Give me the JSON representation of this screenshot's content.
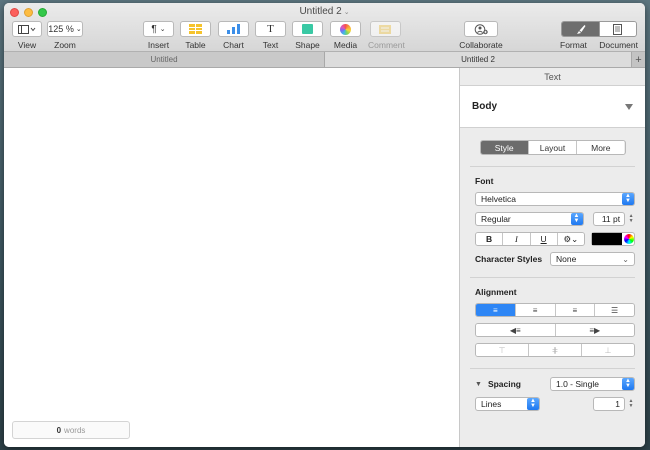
{
  "window": {
    "title": "Untitled 2"
  },
  "toolbar": {
    "view_label": "View",
    "zoom_value": "125 %",
    "zoom_label": "Zoom",
    "insert_label": "Insert",
    "table_label": "Table",
    "chart_label": "Chart",
    "text_label": "Text",
    "shape_label": "Shape",
    "media_label": "Media",
    "comment_label": "Comment",
    "collaborate_label": "Collaborate",
    "format_label": "Format",
    "document_label": "Document"
  },
  "tabs": [
    {
      "label": "Untitled",
      "active": false
    },
    {
      "label": "Untitled 2",
      "active": true
    }
  ],
  "canvas": {
    "word_count": "0",
    "word_count_unit": "words"
  },
  "inspector": {
    "title": "Text",
    "paragraph_style": "Body",
    "subtabs": [
      "Style",
      "Layout",
      "More"
    ],
    "font_section": "Font",
    "font_family": "Helvetica",
    "font_typeface": "Regular",
    "font_size": "11 pt",
    "bold": "B",
    "italic": "I",
    "underline": "U",
    "text_color": "#000000",
    "character_styles_label": "Character Styles",
    "character_styles_value": "None",
    "alignment_section": "Alignment",
    "spacing_label": "Spacing",
    "spacing_value": "1.0 - Single",
    "lines_value": "Lines",
    "lines_count": "1"
  },
  "colors": {
    "accent": "#2e86f5",
    "close": "#fc605c",
    "minimize": "#fdbc40",
    "maximize": "#34c84a"
  }
}
